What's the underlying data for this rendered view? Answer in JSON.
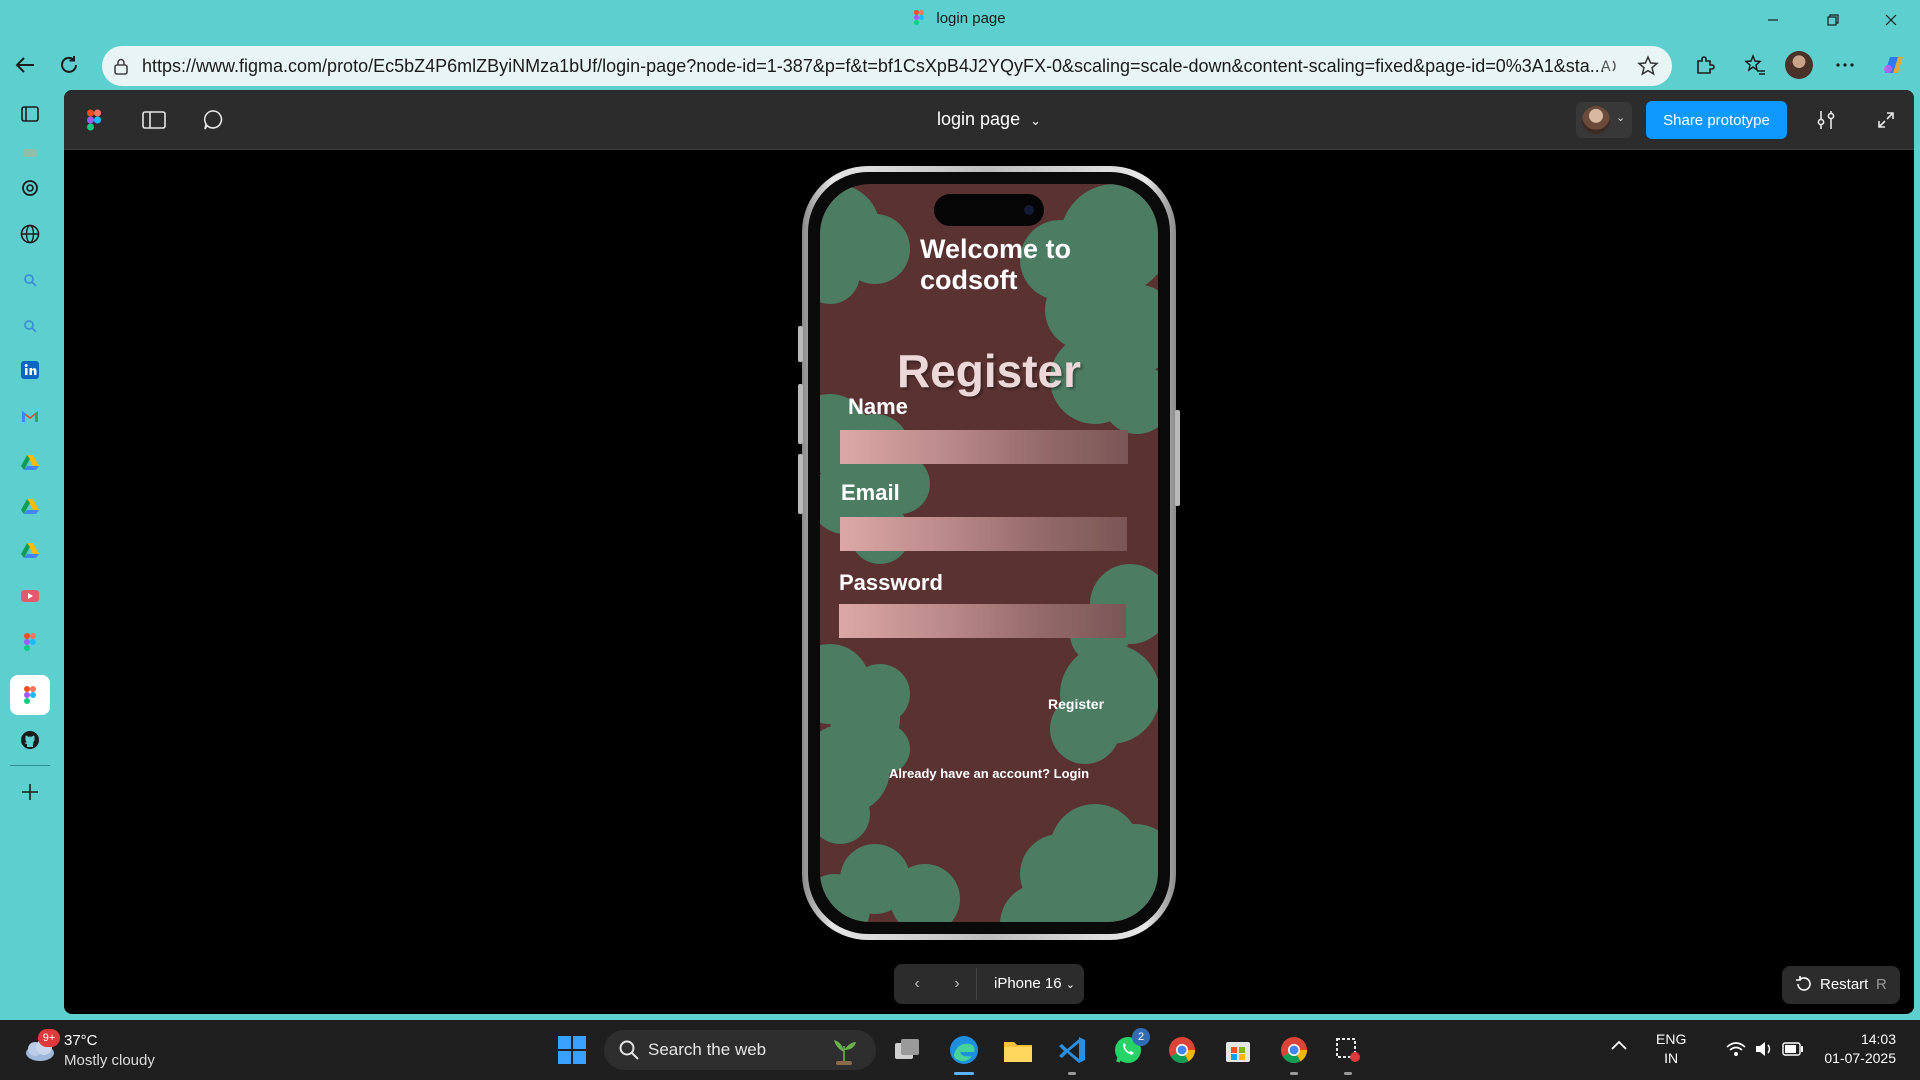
{
  "window": {
    "title": "login page"
  },
  "browser": {
    "url": "https://www.figma.com/proto/Ec5bZ4P6mlZByiNMza1bUf/login-page?node-id=1-387&p=f&t=bf1CsXpB4J2YQyFX-0&scaling=scale-down&content-scaling=fixed&page-id=0%3A1&sta..."
  },
  "figma": {
    "file_title": "login page",
    "share_label": "Share prototype",
    "device_label": "iPhone 16",
    "restart_label": "Restart",
    "restart_key": "R"
  },
  "app": {
    "welcome": "Welcome to codsoft",
    "heading": "Register",
    "name_label": "Name",
    "email_label": "Email",
    "password_label": "Password",
    "register_button": "Register",
    "login_link": "Already have an account? Login",
    "colors": {
      "background": "#5a3232",
      "clouds": "#4c7c62"
    }
  },
  "taskbar": {
    "weather_badge": "9+",
    "temperature": "37°C",
    "weather": "Mostly cloudy",
    "search_placeholder": "Search the web",
    "whatsapp_badge": "2",
    "lang_1": "ENG",
    "lang_2": "IN",
    "time": "14:03",
    "date": "01-07-2025"
  }
}
